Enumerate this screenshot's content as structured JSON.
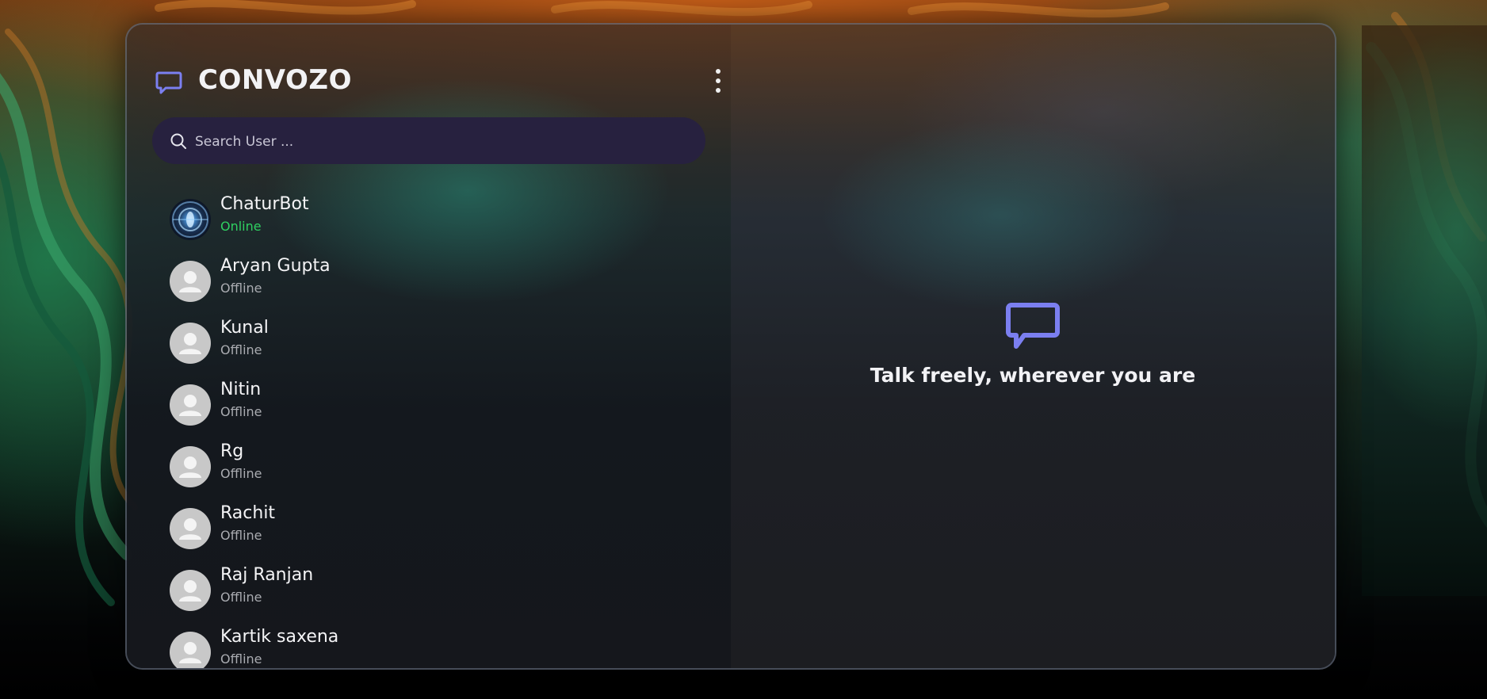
{
  "app": {
    "title": "CONVOZO",
    "brand_icon": "chat-bubble-icon",
    "menu_icon": "more-vertical-icon",
    "accent_color": "#7b7ff0"
  },
  "search": {
    "placeholder": "Search User ...",
    "value": "",
    "icon": "search-icon"
  },
  "contacts": [
    {
      "name": "ChaturBot",
      "status": "Online",
      "avatar": "bot-avatar"
    },
    {
      "name": "Aryan Gupta",
      "status": "Offline",
      "avatar": "default-avatar"
    },
    {
      "name": "Kunal",
      "status": "Offline",
      "avatar": "default-avatar"
    },
    {
      "name": "Nitin",
      "status": "Offline",
      "avatar": "default-avatar"
    },
    {
      "name": "Rg",
      "status": "Offline",
      "avatar": "default-avatar"
    },
    {
      "name": "Rachit",
      "status": "Offline",
      "avatar": "default-avatar"
    },
    {
      "name": "Raj Ranjan",
      "status": "Offline",
      "avatar": "default-avatar"
    },
    {
      "name": "Kartik saxena",
      "status": "Offline",
      "avatar": "default-avatar"
    }
  ],
  "status_colors": {
    "online": "#2fd061",
    "offline": "#a9abb0"
  },
  "welcome": {
    "icon": "chat-bubble-icon",
    "text": "Talk freely, wherever you are"
  }
}
